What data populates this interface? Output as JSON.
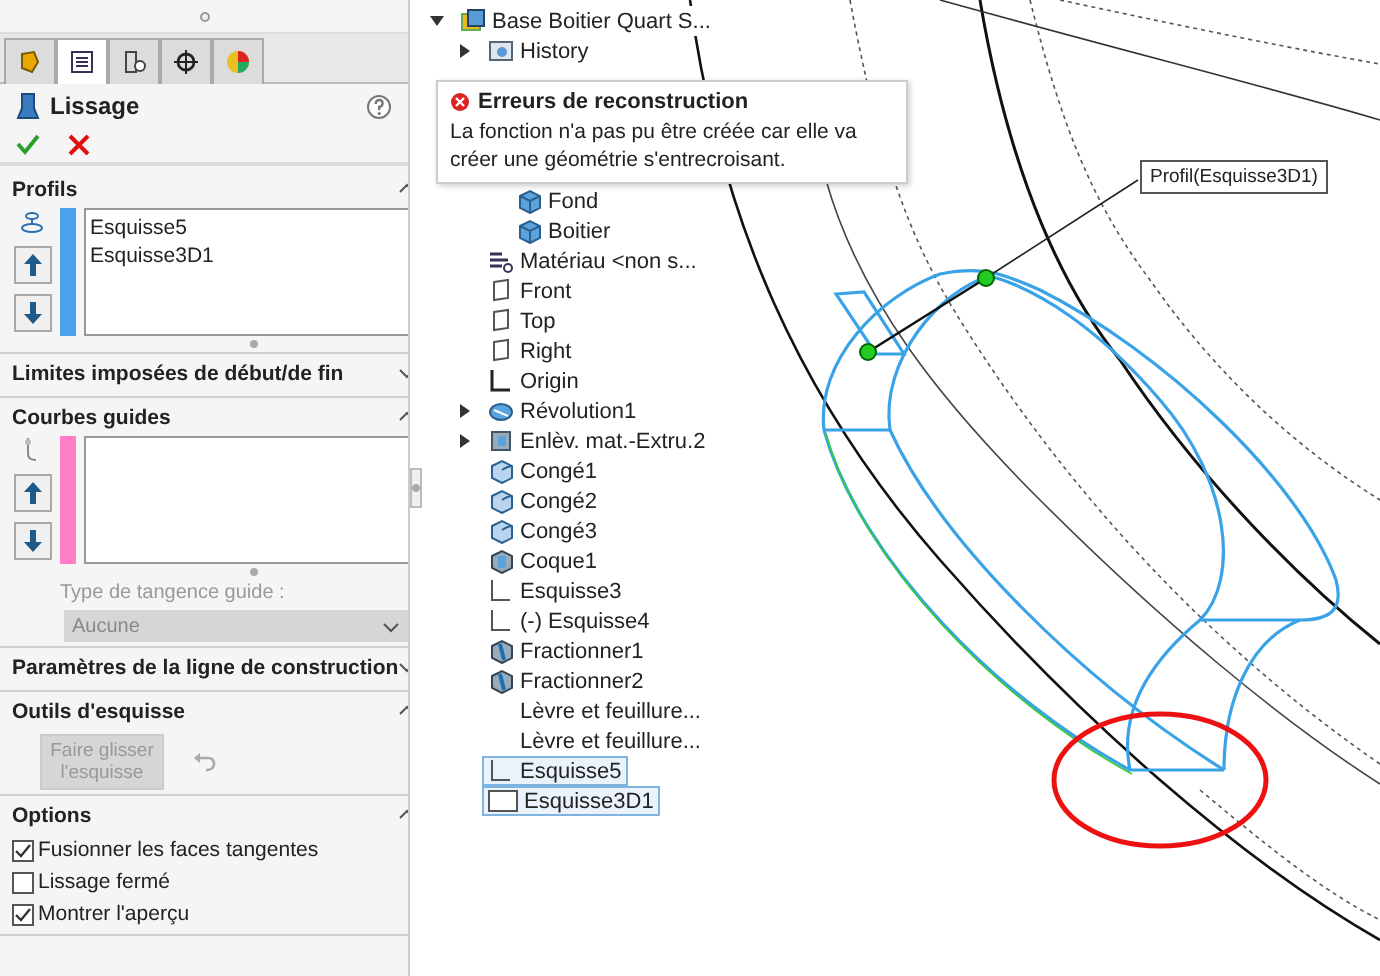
{
  "panel": {
    "tabs": [
      {
        "kind": "feature",
        "selected": false
      },
      {
        "kind": "property",
        "selected": true
      },
      {
        "kind": "config",
        "selected": false
      },
      {
        "kind": "target",
        "selected": false
      },
      {
        "kind": "appearance",
        "selected": false
      }
    ],
    "title": "Lissage",
    "sections": [
      {
        "kind": "profiles",
        "title": "Profils",
        "expanded": true,
        "color": "#4aa3ef",
        "items": [
          "Esquisse5",
          "Esquisse3D1"
        ]
      },
      {
        "kind": "plain",
        "title": "Limites imposées de début/de fin",
        "expanded": false
      },
      {
        "kind": "guides",
        "title": "Courbes guides",
        "expanded": true,
        "color": "#ff7fc6",
        "tangent_label": "Type de tangence guide :",
        "tangent_value": "Aucune"
      },
      {
        "kind": "plain",
        "title": "Paramètres de la ligne de construction",
        "expanded": false
      },
      {
        "kind": "tools",
        "title": "Outils d'esquisse",
        "expanded": true,
        "button": "Faire glisser l'esquisse"
      },
      {
        "kind": "options",
        "title": "Options",
        "expanded": true,
        "options": [
          {
            "label": "Fusionner les faces tangentes",
            "checked": true
          },
          {
            "label": "Lissage fermé",
            "checked": false
          },
          {
            "label": "Montrer l'aperçu",
            "checked": true
          }
        ]
      }
    ]
  },
  "tree": {
    "label": "Base Boitier Quart S...",
    "kind": "part",
    "expanded": true,
    "children": [
      {
        "label": "History",
        "kind": "history",
        "expanded": false
      },
      {
        "children": [
          {
            "label": "Fond",
            "kind": "body"
          },
          {
            "label": "Boitier",
            "kind": "body"
          }
        ]
      },
      {
        "label": "Matériau <non s...",
        "kind": "material"
      },
      {
        "label": "Front",
        "kind": "plane"
      },
      {
        "label": "Top",
        "kind": "plane"
      },
      {
        "label": "Right",
        "kind": "plane"
      },
      {
        "label": "Origin",
        "kind": "origin"
      },
      {
        "label": "Révolution1",
        "kind": "revolve",
        "expanded": false
      },
      {
        "label": "Enlèv. mat.-Extru.2",
        "kind": "cut",
        "expanded": false
      },
      {
        "label": "Congé1",
        "kind": "fillet"
      },
      {
        "label": "Congé2",
        "kind": "fillet"
      },
      {
        "label": "Congé3",
        "kind": "fillet"
      },
      {
        "label": "Coque1",
        "kind": "shell"
      },
      {
        "label": "Esquisse3",
        "kind": "sketch"
      },
      {
        "label": "(-) Esquisse4",
        "kind": "sketch"
      },
      {
        "label": "Fractionner1",
        "kind": "split"
      },
      {
        "label": "Fractionner2",
        "kind": "split"
      },
      {
        "label": "Lèvre et feuillure...",
        "kind": "none"
      },
      {
        "label": "Lèvre et feuillure...",
        "kind": "none"
      },
      {
        "label": "Esquisse5",
        "kind": "sketch",
        "selected": true
      },
      {
        "label": "Esquisse3D1",
        "kind": "sketch3d",
        "selected": true
      }
    ]
  },
  "tooltip": {
    "title": "Erreurs de reconstruction",
    "message": "La fonction n'a pas pu être créée car elle va créer une géométrie s'entrecroisant."
  },
  "callout": {
    "label": "Profil(Esquisse3D1)"
  }
}
